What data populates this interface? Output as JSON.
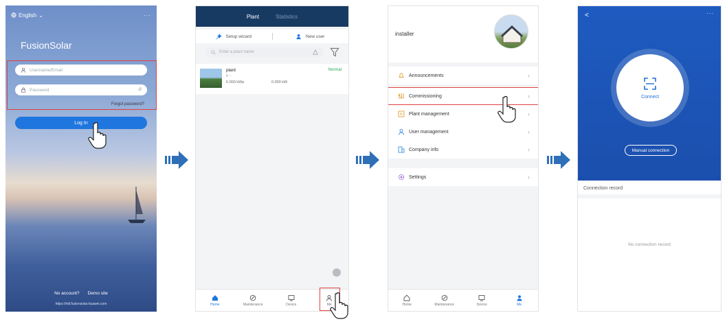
{
  "login": {
    "language": "English",
    "more": "···",
    "app_name": "FusionSolar",
    "username_placeholder": "Username/Email",
    "password_placeholder": "Password",
    "show_password": "Ø",
    "forgot_password": "Forgot password?",
    "login_button": "Log In",
    "no_account": "No account?",
    "demo_site": "Demo site",
    "url": "https://intl.fusionsolar.huawei.com"
  },
  "plants": {
    "tabs": [
      "Plant",
      "Statistics"
    ],
    "active_tab": "Plant",
    "setup_wizard": "Setup wizard",
    "new_user": "New user",
    "search_placeholder": "Enter a plant name",
    "plant": {
      "name": "plant",
      "status": "Normal",
      "sub": "0 ···",
      "capacity": "5.000 kWp",
      "power": "0.000 kW"
    },
    "tabbar": [
      "Home",
      "Maintenance",
      "Device",
      "Me"
    ]
  },
  "me": {
    "username": "installer",
    "menu": [
      "Announcements",
      "Commissioning",
      "Plant management",
      "User management",
      "Company info"
    ],
    "settings": "Settings",
    "tabbar": [
      "Home",
      "Maintenance",
      "Device",
      "Me"
    ]
  },
  "connect": {
    "back": "<",
    "more": "···",
    "connect_label": "Connect",
    "manual_connection": "Manual connection",
    "record_title": "Connection record",
    "empty_text": "No connection record"
  },
  "colors": {
    "accent_blue": "#1f76de",
    "header_navy": "#173a63",
    "highlight_red": "#e04040",
    "status_green": "#2aa65a",
    "arrow_blue": "#2f6fb8"
  }
}
